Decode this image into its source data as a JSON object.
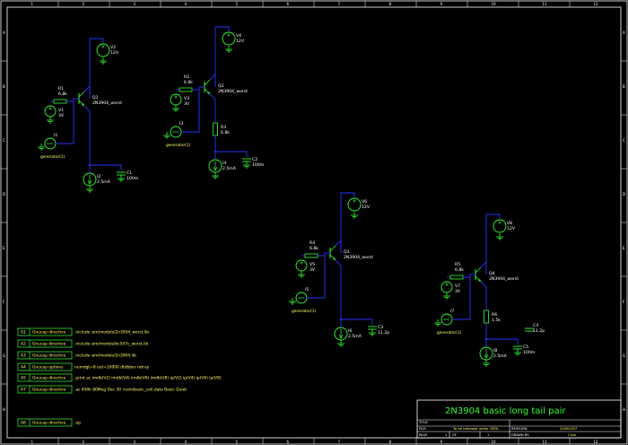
{
  "frame": {
    "top_numbers": [
      "1",
      "2",
      "3",
      "4",
      "5",
      "6",
      "7",
      "8",
      "9",
      "10",
      "11",
      "12"
    ],
    "side_letters": [
      "A",
      "B",
      "C",
      "D",
      "E",
      "F",
      "G",
      "H"
    ]
  },
  "title_block": {
    "title": "2N3904 basic long tail pair",
    "title_label": "TITLE",
    "file_label": "FILE:",
    "file_value": "To be released under GPDL",
    "revision_label": "REVISION:",
    "revision_value": "20081007",
    "page_label": "PAGE",
    "page_value": "1",
    "of_label": "OF",
    "of_value": "1",
    "drawn_label": "DRAWN BY:",
    "drawn_value": "Click"
  },
  "directives": [
    {
      "ref": "A1",
      "type": "Gnucap directive",
      "text": ".include sim/models/2n3904_worst.lib"
    },
    {
      "ref": "A2",
      "type": "Gnucap directive",
      "text": ".include sim/models/bc547c_worst.lib"
    },
    {
      "ref": "A3",
      "type": "Gnucap directive",
      "text": ".include sim/models/2n3904.lib"
    },
    {
      "ref": "A4",
      "type": "Gnucap options",
      "text": "numdgt=8 out=10000 dtdbber retray"
    },
    {
      "ref": "A5",
      "type": "Gnucap directive",
      "text": ".print ac imdb(V2) imdb(V4) imdb(V6) imdb(V8) ip(V2) ip(V4) ip(V6) ip(V8)"
    },
    {
      "ref": "A7",
      "type": "Gnucap directive",
      "text": ".ac 400k 80Meg Dec 30 >sim/basic_cell.data Basic Quiet"
    },
    {
      "ref": "A6",
      "type": "Gnucap directive",
      "text": ".op"
    }
  ],
  "circuits": [
    {
      "supply": {
        "ref": "V2",
        "value": "12V"
      },
      "resistor": {
        "ref": "R1",
        "value": "6.8k"
      },
      "source": {
        "ref": "V1",
        "value": "3V"
      },
      "transistor": {
        "ref": "Q1",
        "model": "2N3904_worst"
      },
      "generator": {
        "ref": "I1",
        "label": "generator(1)"
      },
      "emitter_resistor": null,
      "current_source": {
        "ref": "I2",
        "value": "2.5mA"
      },
      "cap": {
        "ref": "C1",
        "value": "100m"
      }
    },
    {
      "supply": {
        "ref": "V4",
        "value": "12V"
      },
      "resistor": {
        "ref": "R2",
        "value": "6.8k"
      },
      "source": {
        "ref": "V3",
        "value": "3V"
      },
      "transistor": {
        "ref": "Q2",
        "model": "2N3904_worst"
      },
      "generator": {
        "ref": "I3",
        "label": "generator(1)"
      },
      "emitter_resistor": {
        "ref": "R3",
        "value": "6.8k"
      },
      "current_source": {
        "ref": "I4",
        "value": "2.5mA"
      },
      "cap": {
        "ref": "C2",
        "value": "100m"
      }
    },
    {
      "supply": {
        "ref": "V6",
        "value": "12V"
      },
      "resistor": {
        "ref": "R4",
        "value": "6.8k"
      },
      "source": {
        "ref": "V5",
        "value": "3V"
      },
      "transistor": {
        "ref": "Q3",
        "model": "2N3904_worst"
      },
      "generator": {
        "ref": "I5",
        "label": "generator(1)"
      },
      "emitter_resistor": null,
      "current_source": {
        "ref": "I6",
        "value": "2.5mA"
      },
      "cap": {
        "ref": "C3",
        "value": "11.2p"
      }
    },
    {
      "supply": {
        "ref": "V8",
        "value": "12V"
      },
      "resistor": {
        "ref": "R5",
        "value": "6.8k"
      },
      "source": {
        "ref": "V7",
        "value": "3V"
      },
      "transistor": {
        "ref": "Q4",
        "model": "2N3904_worst"
      },
      "generator": {
        "ref": "I7",
        "label": "generator(1)"
      },
      "emitter_resistor": {
        "ref": "R6",
        "value": "1.5k"
      },
      "extra_cap": {
        "ref": "C4",
        "value": "11.2p"
      },
      "current_source": {
        "ref": "I8",
        "value": "2.5mA"
      },
      "cap": {
        "ref": "C5",
        "value": "100m"
      }
    }
  ],
  "colors": {
    "wire": "#2233ff",
    "component": "#33ff33",
    "frame": "#ffffff",
    "text": "#ffff66",
    "background": "#000000"
  }
}
